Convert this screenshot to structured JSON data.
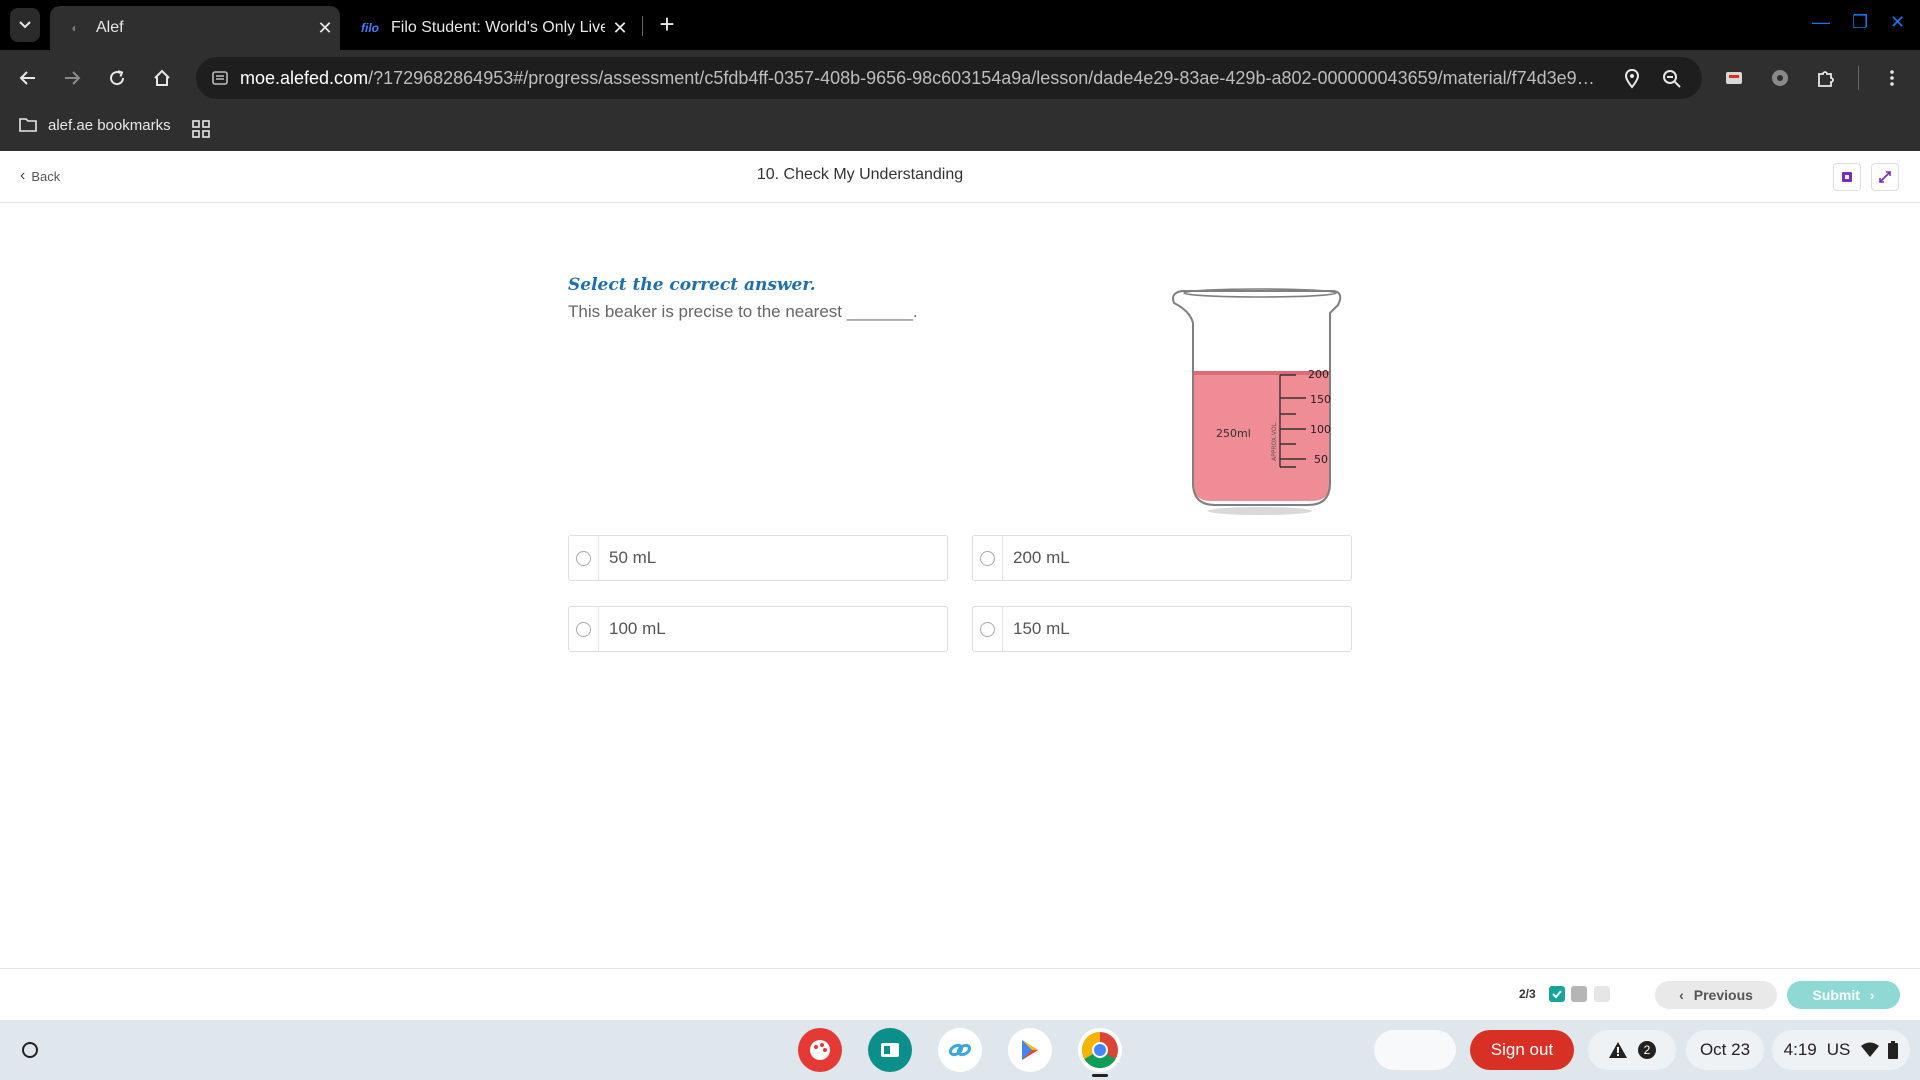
{
  "browser": {
    "tabs": [
      {
        "title": "Alef",
        "active": true
      },
      {
        "title": "Filo Student: World's Only Live I",
        "favicon_text": "filo",
        "active": false
      }
    ],
    "url_host": "moe.alefed.com",
    "url_path": "/?1729682864953#/progress/assessment/c5fdb4ff-0357-408b-9656-98c603154a9a/lesson/dade4e29-83ae-429b-a802-000000043659/material/f74d3e9a-a...",
    "bookmarks": [
      {
        "label": "alef.ae bookmarks"
      }
    ]
  },
  "header": {
    "back_label": "Back",
    "page_title": "10. Check My Understanding"
  },
  "question": {
    "instruction": "Select the correct answer.",
    "prompt": "This beaker is precise to the nearest _______.",
    "image": {
      "beaker_label": "250ml",
      "side_label": "APPROX.VOL.",
      "marks": [
        "200",
        "150",
        "100",
        "50"
      ],
      "liquid_color": "#f08c95"
    },
    "options": [
      {
        "label": "50 mL"
      },
      {
        "label": "200 mL"
      },
      {
        "label": "100 mL"
      },
      {
        "label": "150 mL"
      }
    ]
  },
  "footer": {
    "progress": "2/3",
    "previous_label": "Previous",
    "submit_label": "Submit"
  },
  "shelf": {
    "signout_label": "Sign out",
    "notification_count": "2",
    "date": "Oct 23",
    "time": "4:19",
    "locale": "US"
  },
  "colors": {
    "accent": "#1f6fa8",
    "submit": "#8ed9d4",
    "signout": "#d93025",
    "progress_done": "#16a49b"
  }
}
